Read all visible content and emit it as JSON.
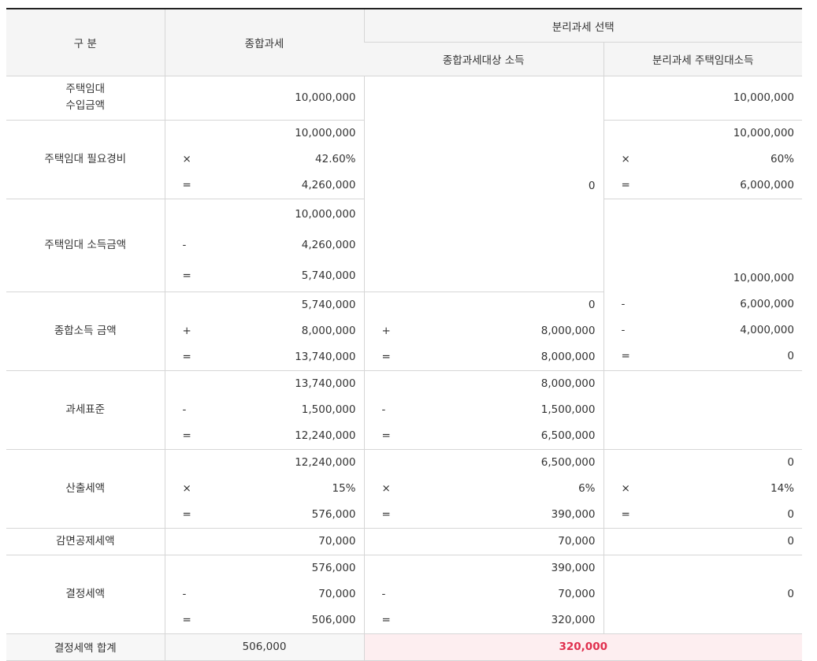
{
  "header": {
    "gubun": "구 분",
    "general": "종합과세",
    "separate": "분리과세 선택",
    "separate_general": "종합과세대상 소득",
    "separate_rental": "분리과세 주택임대소득"
  },
  "rows": {
    "rental_income": {
      "label": "주택임대\n수입금액",
      "label_line1": "주택임대",
      "label_line2": "수입금액",
      "general": "10,000,000",
      "rental": "10,000,000"
    },
    "expenses": {
      "label": "주택임대 필요경비",
      "general": [
        {
          "op": "",
          "val": "10,000,000"
        },
        {
          "op": "×",
          "val": "42.60%"
        },
        {
          "op": "=",
          "val": "4,260,000"
        }
      ],
      "rental": [
        {
          "op": "",
          "val": "10,000,000"
        },
        {
          "op": "×",
          "val": "60%"
        },
        {
          "op": "=",
          "val": "6,000,000"
        }
      ],
      "separate_general_merged": "0"
    },
    "rental_net": {
      "label": "주택임대 소득금액",
      "general": [
        {
          "op": "",
          "val": "10,000,000"
        },
        {
          "op": "-",
          "val": "4,260,000"
        },
        {
          "op": "=",
          "val": "5,740,000"
        }
      ]
    },
    "total_income": {
      "label": "종합소득 금액",
      "general": [
        {
          "op": "",
          "val": "5,740,000"
        },
        {
          "op": "+",
          "val": "8,000,000"
        },
        {
          "op": "=",
          "val": "13,740,000"
        }
      ],
      "separate_general": [
        {
          "op": "",
          "val": "0"
        },
        {
          "op": "+",
          "val": "8,000,000"
        },
        {
          "op": "=",
          "val": "8,000,000"
        }
      ],
      "rental": [
        {
          "op": "",
          "val": "10,000,000"
        },
        {
          "op": "-",
          "val": "6,000,000"
        },
        {
          "op": "-",
          "val": "4,000,000"
        },
        {
          "op": "=",
          "val": "0"
        }
      ]
    },
    "tax_base": {
      "label": "과세표준",
      "general": [
        {
          "op": "",
          "val": "13,740,000"
        },
        {
          "op": "-",
          "val": "1,500,000"
        },
        {
          "op": "=",
          "val": "12,240,000"
        }
      ],
      "separate_general": [
        {
          "op": "",
          "val": "8,000,000"
        },
        {
          "op": "-",
          "val": "1,500,000"
        },
        {
          "op": "=",
          "val": "6,500,000"
        }
      ]
    },
    "calculated_tax": {
      "label": "산출세액",
      "general": [
        {
          "op": "",
          "val": "12,240,000"
        },
        {
          "op": "×",
          "val": "15%"
        },
        {
          "op": "=",
          "val": "576,000"
        }
      ],
      "separate_general": [
        {
          "op": "",
          "val": "6,500,000"
        },
        {
          "op": "×",
          "val": "6%"
        },
        {
          "op": "=",
          "val": "390,000"
        }
      ],
      "rental": [
        {
          "op": "",
          "val": "0"
        },
        {
          "op": "×",
          "val": "14%"
        },
        {
          "op": "=",
          "val": "0"
        }
      ]
    },
    "deduction": {
      "label": "감면공제세액",
      "general": "70,000",
      "separate_general": "70,000",
      "rental": "0"
    },
    "determined_tax": {
      "label": "결정세액",
      "general": [
        {
          "op": "",
          "val": "576,000"
        },
        {
          "op": "-",
          "val": "70,000"
        },
        {
          "op": "=",
          "val": "506,000"
        }
      ],
      "separate_general": [
        {
          "op": "",
          "val": "390,000"
        },
        {
          "op": "-",
          "val": "70,000"
        },
        {
          "op": "=",
          "val": "320,000"
        }
      ],
      "rental": "0"
    },
    "total": {
      "label": "결정세액 합계",
      "general": "506,000",
      "separate": "320,000"
    }
  },
  "colors": {
    "header_bg": "#f5f5f5",
    "border": "#d6d6d6",
    "highlight_bg": "#fdeef0",
    "highlight_text": "#e0304e"
  }
}
